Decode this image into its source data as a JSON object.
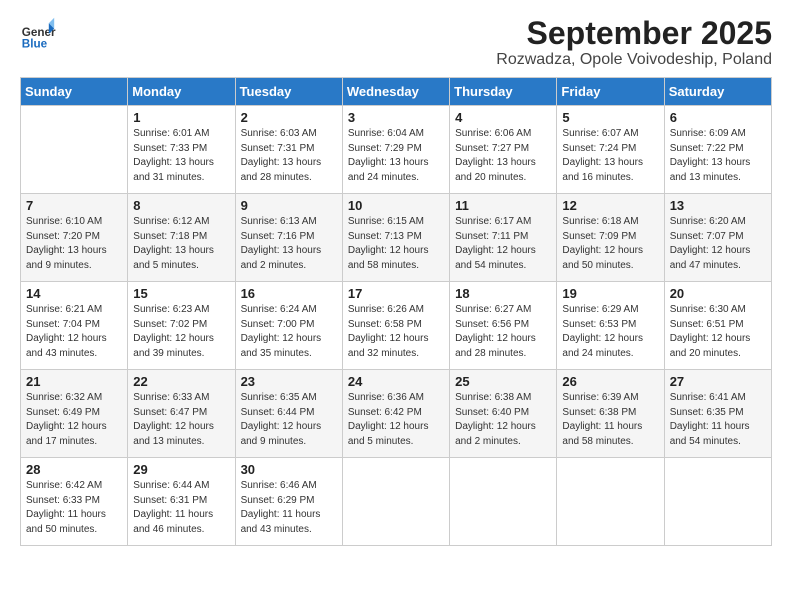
{
  "logo": {
    "general": "General",
    "blue": "Blue"
  },
  "title": "September 2025",
  "subtitle": "Rozwadza, Opole Voivodeship, Poland",
  "headers": [
    "Sunday",
    "Monday",
    "Tuesday",
    "Wednesday",
    "Thursday",
    "Friday",
    "Saturday"
  ],
  "weeks": [
    [
      {
        "day": "",
        "sunrise": "",
        "sunset": "",
        "daylight": ""
      },
      {
        "day": "1",
        "sunrise": "Sunrise: 6:01 AM",
        "sunset": "Sunset: 7:33 PM",
        "daylight": "Daylight: 13 hours and 31 minutes."
      },
      {
        "day": "2",
        "sunrise": "Sunrise: 6:03 AM",
        "sunset": "Sunset: 7:31 PM",
        "daylight": "Daylight: 13 hours and 28 minutes."
      },
      {
        "day": "3",
        "sunrise": "Sunrise: 6:04 AM",
        "sunset": "Sunset: 7:29 PM",
        "daylight": "Daylight: 13 hours and 24 minutes."
      },
      {
        "day": "4",
        "sunrise": "Sunrise: 6:06 AM",
        "sunset": "Sunset: 7:27 PM",
        "daylight": "Daylight: 13 hours and 20 minutes."
      },
      {
        "day": "5",
        "sunrise": "Sunrise: 6:07 AM",
        "sunset": "Sunset: 7:24 PM",
        "daylight": "Daylight: 13 hours and 16 minutes."
      },
      {
        "day": "6",
        "sunrise": "Sunrise: 6:09 AM",
        "sunset": "Sunset: 7:22 PM",
        "daylight": "Daylight: 13 hours and 13 minutes."
      }
    ],
    [
      {
        "day": "7",
        "sunrise": "Sunrise: 6:10 AM",
        "sunset": "Sunset: 7:20 PM",
        "daylight": "Daylight: 13 hours and 9 minutes."
      },
      {
        "day": "8",
        "sunrise": "Sunrise: 6:12 AM",
        "sunset": "Sunset: 7:18 PM",
        "daylight": "Daylight: 13 hours and 5 minutes."
      },
      {
        "day": "9",
        "sunrise": "Sunrise: 6:13 AM",
        "sunset": "Sunset: 7:16 PM",
        "daylight": "Daylight: 13 hours and 2 minutes."
      },
      {
        "day": "10",
        "sunrise": "Sunrise: 6:15 AM",
        "sunset": "Sunset: 7:13 PM",
        "daylight": "Daylight: 12 hours and 58 minutes."
      },
      {
        "day": "11",
        "sunrise": "Sunrise: 6:17 AM",
        "sunset": "Sunset: 7:11 PM",
        "daylight": "Daylight: 12 hours and 54 minutes."
      },
      {
        "day": "12",
        "sunrise": "Sunrise: 6:18 AM",
        "sunset": "Sunset: 7:09 PM",
        "daylight": "Daylight: 12 hours and 50 minutes."
      },
      {
        "day": "13",
        "sunrise": "Sunrise: 6:20 AM",
        "sunset": "Sunset: 7:07 PM",
        "daylight": "Daylight: 12 hours and 47 minutes."
      }
    ],
    [
      {
        "day": "14",
        "sunrise": "Sunrise: 6:21 AM",
        "sunset": "Sunset: 7:04 PM",
        "daylight": "Daylight: 12 hours and 43 minutes."
      },
      {
        "day": "15",
        "sunrise": "Sunrise: 6:23 AM",
        "sunset": "Sunset: 7:02 PM",
        "daylight": "Daylight: 12 hours and 39 minutes."
      },
      {
        "day": "16",
        "sunrise": "Sunrise: 6:24 AM",
        "sunset": "Sunset: 7:00 PM",
        "daylight": "Daylight: 12 hours and 35 minutes."
      },
      {
        "day": "17",
        "sunrise": "Sunrise: 6:26 AM",
        "sunset": "Sunset: 6:58 PM",
        "daylight": "Daylight: 12 hours and 32 minutes."
      },
      {
        "day": "18",
        "sunrise": "Sunrise: 6:27 AM",
        "sunset": "Sunset: 6:56 PM",
        "daylight": "Daylight: 12 hours and 28 minutes."
      },
      {
        "day": "19",
        "sunrise": "Sunrise: 6:29 AM",
        "sunset": "Sunset: 6:53 PM",
        "daylight": "Daylight: 12 hours and 24 minutes."
      },
      {
        "day": "20",
        "sunrise": "Sunrise: 6:30 AM",
        "sunset": "Sunset: 6:51 PM",
        "daylight": "Daylight: 12 hours and 20 minutes."
      }
    ],
    [
      {
        "day": "21",
        "sunrise": "Sunrise: 6:32 AM",
        "sunset": "Sunset: 6:49 PM",
        "daylight": "Daylight: 12 hours and 17 minutes."
      },
      {
        "day": "22",
        "sunrise": "Sunrise: 6:33 AM",
        "sunset": "Sunset: 6:47 PM",
        "daylight": "Daylight: 12 hours and 13 minutes."
      },
      {
        "day": "23",
        "sunrise": "Sunrise: 6:35 AM",
        "sunset": "Sunset: 6:44 PM",
        "daylight": "Daylight: 12 hours and 9 minutes."
      },
      {
        "day": "24",
        "sunrise": "Sunrise: 6:36 AM",
        "sunset": "Sunset: 6:42 PM",
        "daylight": "Daylight: 12 hours and 5 minutes."
      },
      {
        "day": "25",
        "sunrise": "Sunrise: 6:38 AM",
        "sunset": "Sunset: 6:40 PM",
        "daylight": "Daylight: 12 hours and 2 minutes."
      },
      {
        "day": "26",
        "sunrise": "Sunrise: 6:39 AM",
        "sunset": "Sunset: 6:38 PM",
        "daylight": "Daylight: 11 hours and 58 minutes."
      },
      {
        "day": "27",
        "sunrise": "Sunrise: 6:41 AM",
        "sunset": "Sunset: 6:35 PM",
        "daylight": "Daylight: 11 hours and 54 minutes."
      }
    ],
    [
      {
        "day": "28",
        "sunrise": "Sunrise: 6:42 AM",
        "sunset": "Sunset: 6:33 PM",
        "daylight": "Daylight: 11 hours and 50 minutes."
      },
      {
        "day": "29",
        "sunrise": "Sunrise: 6:44 AM",
        "sunset": "Sunset: 6:31 PM",
        "daylight": "Daylight: 11 hours and 46 minutes."
      },
      {
        "day": "30",
        "sunrise": "Sunrise: 6:46 AM",
        "sunset": "Sunset: 6:29 PM",
        "daylight": "Daylight: 11 hours and 43 minutes."
      },
      {
        "day": "",
        "sunrise": "",
        "sunset": "",
        "daylight": ""
      },
      {
        "day": "",
        "sunrise": "",
        "sunset": "",
        "daylight": ""
      },
      {
        "day": "",
        "sunrise": "",
        "sunset": "",
        "daylight": ""
      },
      {
        "day": "",
        "sunrise": "",
        "sunset": "",
        "daylight": ""
      }
    ]
  ]
}
